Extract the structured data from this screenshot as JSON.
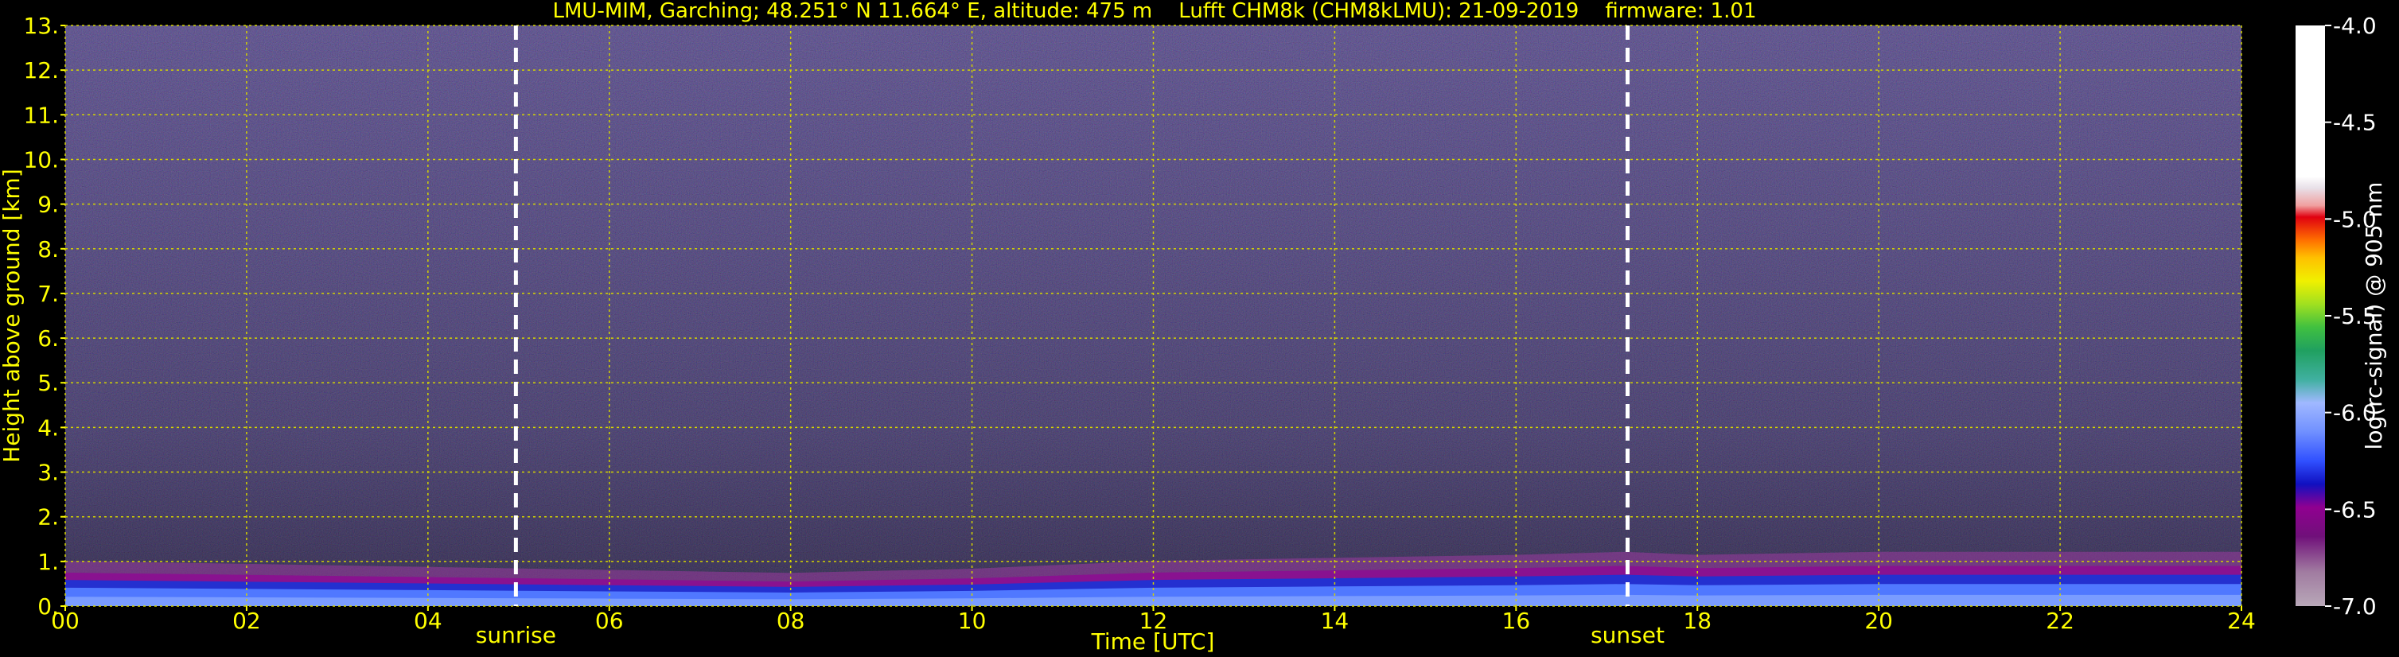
{
  "chart_data": {
    "type": "heatmap",
    "title": "LMU-MIM, Garching; 48.251° N 11.664° E, altitude: 475 m    Lufft CHM8k (CHM8kLMU): 21-09-2019    firmware: 1.01",
    "xlabel": "Time [UTC]",
    "ylabel": "Height above ground [km]",
    "xlim": [
      0,
      24
    ],
    "ylim": [
      0,
      13
    ],
    "x_ticks": [
      "00",
      "02",
      "04",
      "06",
      "08",
      "10",
      "12",
      "14",
      "16",
      "18",
      "20",
      "22",
      "24"
    ],
    "y_ticks": [
      "0.",
      "1.",
      "2.",
      "3.",
      "4.",
      "5.",
      "6.",
      "7.",
      "8.",
      "9.",
      "10.",
      "11.",
      "12.",
      "13."
    ],
    "grid": true,
    "annotations": [
      {
        "label": "sunrise",
        "x": 4.97
      },
      {
        "label": "sunset",
        "x": 17.23
      }
    ],
    "colorbar": {
      "label": "log(rc-signal) @ 905 nm",
      "range": [
        -7.0,
        -4.0
      ],
      "ticks": [
        "-4.0",
        "-4.5",
        "-5.0",
        "-5.5",
        "-6.0",
        "-6.5",
        "-7.0"
      ]
    },
    "aerosol_layer_top_km": [
      {
        "x": 0,
        "y": 0.75
      },
      {
        "x": 2,
        "y": 0.7
      },
      {
        "x": 4,
        "y": 0.65
      },
      {
        "x": 6,
        "y": 0.6
      },
      {
        "x": 8,
        "y": 0.55
      },
      {
        "x": 10,
        "y": 0.62
      },
      {
        "x": 12,
        "y": 0.75
      },
      {
        "x": 14,
        "y": 0.8
      },
      {
        "x": 16,
        "y": 0.85
      },
      {
        "x": 17.2,
        "y": 0.9
      },
      {
        "x": 18,
        "y": 0.85
      },
      {
        "x": 20,
        "y": 0.9
      },
      {
        "x": 22,
        "y": 0.9
      },
      {
        "x": 24,
        "y": 0.9
      }
    ]
  },
  "colors": {
    "axis_text": "#ffff00",
    "grid": "#d4d400",
    "background": "#000000",
    "noise_base": "#3a3060",
    "marker_line": "#ffffff"
  }
}
